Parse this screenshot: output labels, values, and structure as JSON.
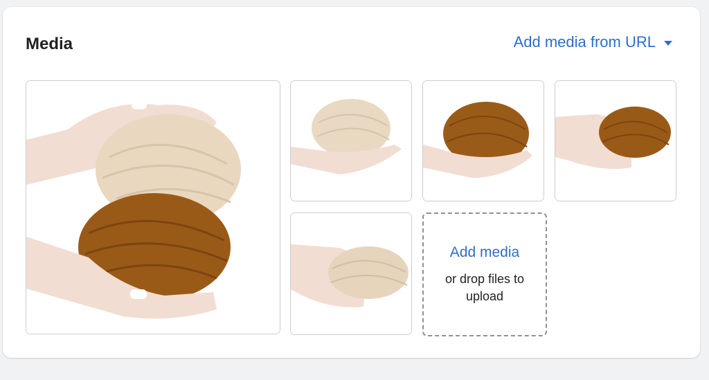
{
  "card": {
    "title": "Media",
    "add_from_url_label": "Add media from URL"
  },
  "media": [
    {
      "name": "Two yarn balls (beige and ochre) held in hands",
      "colors": [
        "#e9d7c0",
        "#9a5a17"
      ]
    },
    {
      "name": "Beige yarn ball on palm",
      "colors": [
        "#e9d9c3"
      ]
    },
    {
      "name": "Ochre yarn ball on palm",
      "colors": [
        "#9b5b18"
      ]
    },
    {
      "name": "Ochre yarn ball held in hand",
      "colors": [
        "#9a5a17"
      ]
    },
    {
      "name": "Beige yarn ball held in hand",
      "colors": [
        "#e6d4bd"
      ]
    }
  ],
  "upload": {
    "link": "Add media",
    "hint": "or drop files to upload"
  },
  "colors": {
    "accent": "#2c6ecb",
    "text": "#202223",
    "border": "#c9cccf",
    "skin": "#f2ddd2"
  }
}
